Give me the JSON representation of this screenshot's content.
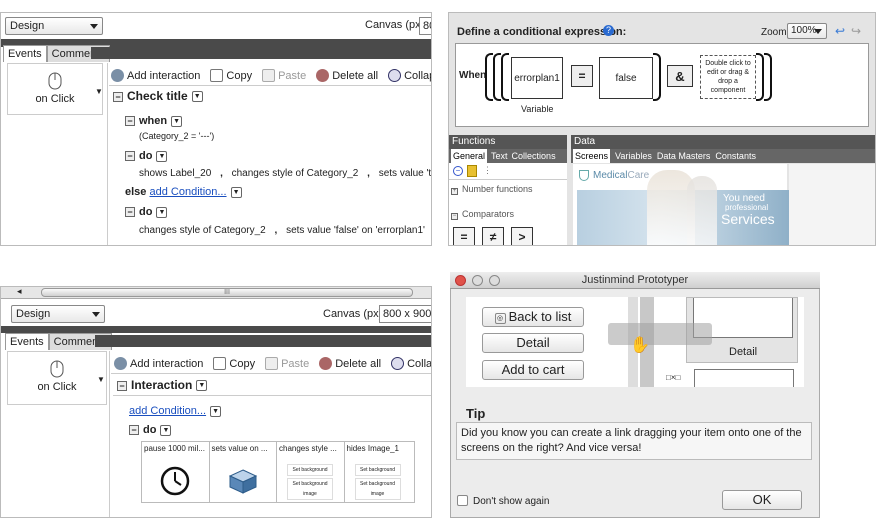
{
  "p1": {
    "design_select": "Design",
    "canvas_label": "Canvas (px):",
    "canvas_value": "80",
    "tabs": [
      "Events",
      "Comments"
    ],
    "event": "on Click",
    "toolbar": [
      "Add interaction",
      "Copy",
      "Paste",
      "Delete all",
      "Collapse all"
    ],
    "check_title": "Check title",
    "when": "when",
    "condition": "(Category_2 = '---')",
    "do1": "do",
    "action1": "shows Label_20",
    "action2": "changes style of Category_2",
    "action3": "sets value 'true' on 'er",
    "else": "else",
    "add_condition": "add Condition...",
    "do2": "do",
    "action4": "changes style of Category_2",
    "action5": "sets value 'false' on 'errorplan1'"
  },
  "p2": {
    "title": "Define a conditional expression:",
    "zoom_label": "Zoom:",
    "zoom_value": "100%",
    "when": "When",
    "var_box": "errorplan1",
    "var_caption": "Variable",
    "eq": "=",
    "value_box": "false",
    "and": "&",
    "hint": "Double click to edit or drag & drop a component",
    "functions_header": "Functions",
    "functions_tabs": [
      "General",
      "Text",
      "Collections"
    ],
    "number_functions": "Number functions",
    "comparators": "Comparators",
    "comp_buttons": [
      "=",
      "≠",
      ">"
    ],
    "data_header": "Data",
    "data_tabs": [
      "Screens",
      "Variables",
      "Data Masters",
      "Constants"
    ],
    "brand": "Medical",
    "brand2": "Care",
    "hero_text1": "You need",
    "hero_text2": "professional",
    "hero_text3": "Services"
  },
  "p3": {
    "design_select": "Design",
    "scroll_mark": "III",
    "canvas_label": "Canvas (px):",
    "canvas_value": "800 x 900",
    "tabs": [
      "Events",
      "Comments"
    ],
    "event": "on Click",
    "toolbar": [
      "Add interaction",
      "Copy",
      "Paste",
      "Delete all",
      "Collapse al"
    ],
    "interaction": "Interaction",
    "add_condition": "add Condition...",
    "do": "do",
    "cards": [
      "pause 1000 mil...",
      "sets value on ...",
      "changes style ...",
      "hides Image_1"
    ],
    "card_sub": [
      "Set background",
      "Set background image"
    ]
  },
  "p4": {
    "window_title": "Justinmind Prototyper",
    "back_to_list": "Back to list",
    "detail": "Detail",
    "add_to_cart": "Add to cart",
    "detail_caption": "Detail",
    "tip_title": "Tip",
    "tip_text": "Did you know you can create a link dragging your item onto one of the screens on the right? And vice versa!",
    "dont_show": "Don't show again",
    "ok": "OK"
  }
}
